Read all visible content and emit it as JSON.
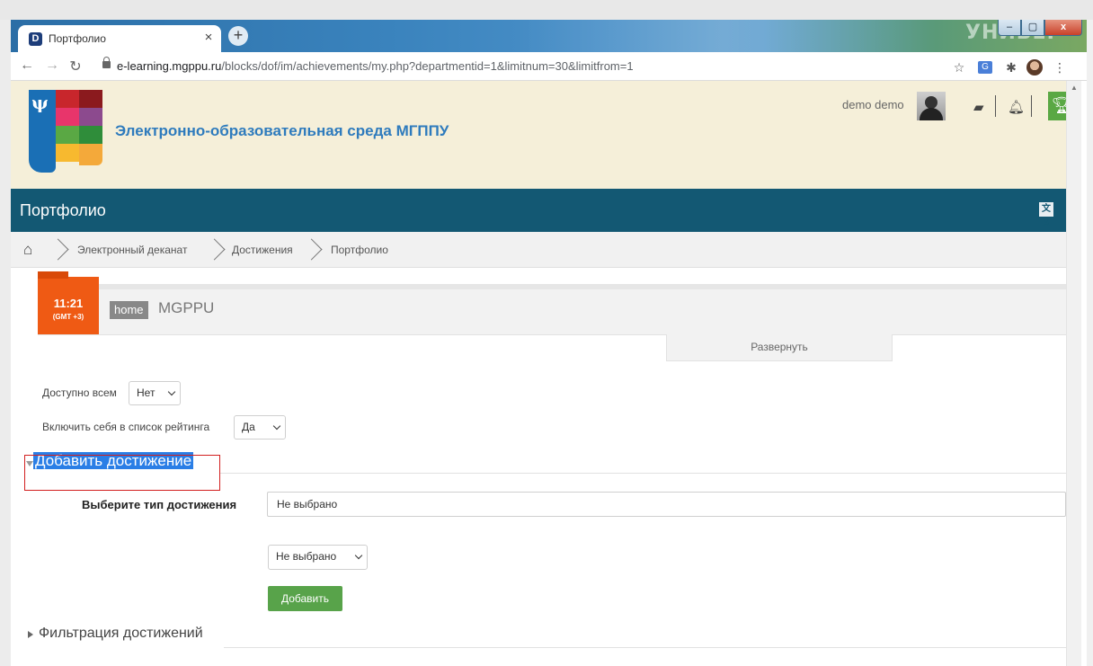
{
  "browser": {
    "tab_title": "Портфолио",
    "tab_close": "×",
    "new_tab": "+",
    "brand_bg_text": "УНИВЕР",
    "url_host": "e-learning.mgppu.ru",
    "url_path": "/blocks/dof/im/achievements/my.php?departmentid=1&limitnum=30&limitfrom=1",
    "window_controls": {
      "minimize": "–",
      "maximize": "▢",
      "close": "x"
    }
  },
  "header": {
    "site_title": "Электронно-образовательная среда МГППУ",
    "user_name": "demo demo"
  },
  "navbar": {
    "title": "Портфолио"
  },
  "breadcrumb": {
    "items": [
      "Электронный деканат",
      "Достижения",
      "Портфолио"
    ]
  },
  "dof": {
    "time": "11:21",
    "timezone": "(GMT +3)",
    "home_label": "home",
    "org": "MGPPU",
    "expand_label": "Развернуть"
  },
  "settings": {
    "available_all_label": "Доступно всем",
    "available_all_value": "Нет",
    "include_rating_label": "Включить себя в список рейтинга",
    "include_rating_value": "Да"
  },
  "add_section": {
    "title": "Добавить достижение",
    "type_label": "Выберите тип достижения",
    "type_value": "Не выбрано",
    "sub_select_value": "Не выбрано",
    "add_button": "Добавить"
  },
  "filter_section": {
    "title": "Фильтрация достижений"
  },
  "colors": {
    "navbar": "#135873",
    "header_bg": "#f5efd9",
    "accent_orange": "#ef5a14",
    "button_green": "#58a34a",
    "highlight_blue": "#2a7ee6",
    "annotation_red": "#d21f1f"
  }
}
